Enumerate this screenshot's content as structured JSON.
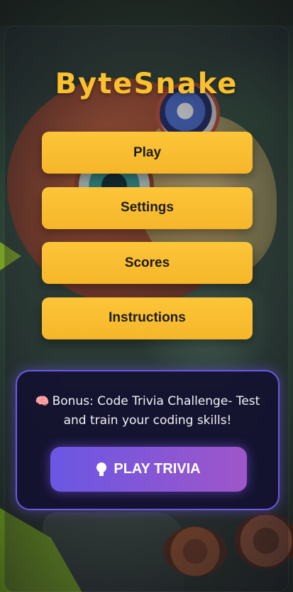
{
  "app": {
    "title": "ByteSnake"
  },
  "menu": {
    "items": [
      {
        "label": "Play"
      },
      {
        "label": "Settings"
      },
      {
        "label": "Scores"
      },
      {
        "label": "Instructions"
      }
    ]
  },
  "trivia": {
    "icon": "brain-icon",
    "icon_glyph": "🧠",
    "description": "Bonus: Code Trivia Challenge- Test and train your coding skills!",
    "button_icon": "lightbulb-icon",
    "button_label": "PLAY TRIVIA"
  },
  "colors": {
    "accent_yellow": "#fbc02d",
    "trivia_border": "#6c58e6",
    "trivia_button_start": "#6a57e3",
    "trivia_button_end": "#9f56c9"
  }
}
